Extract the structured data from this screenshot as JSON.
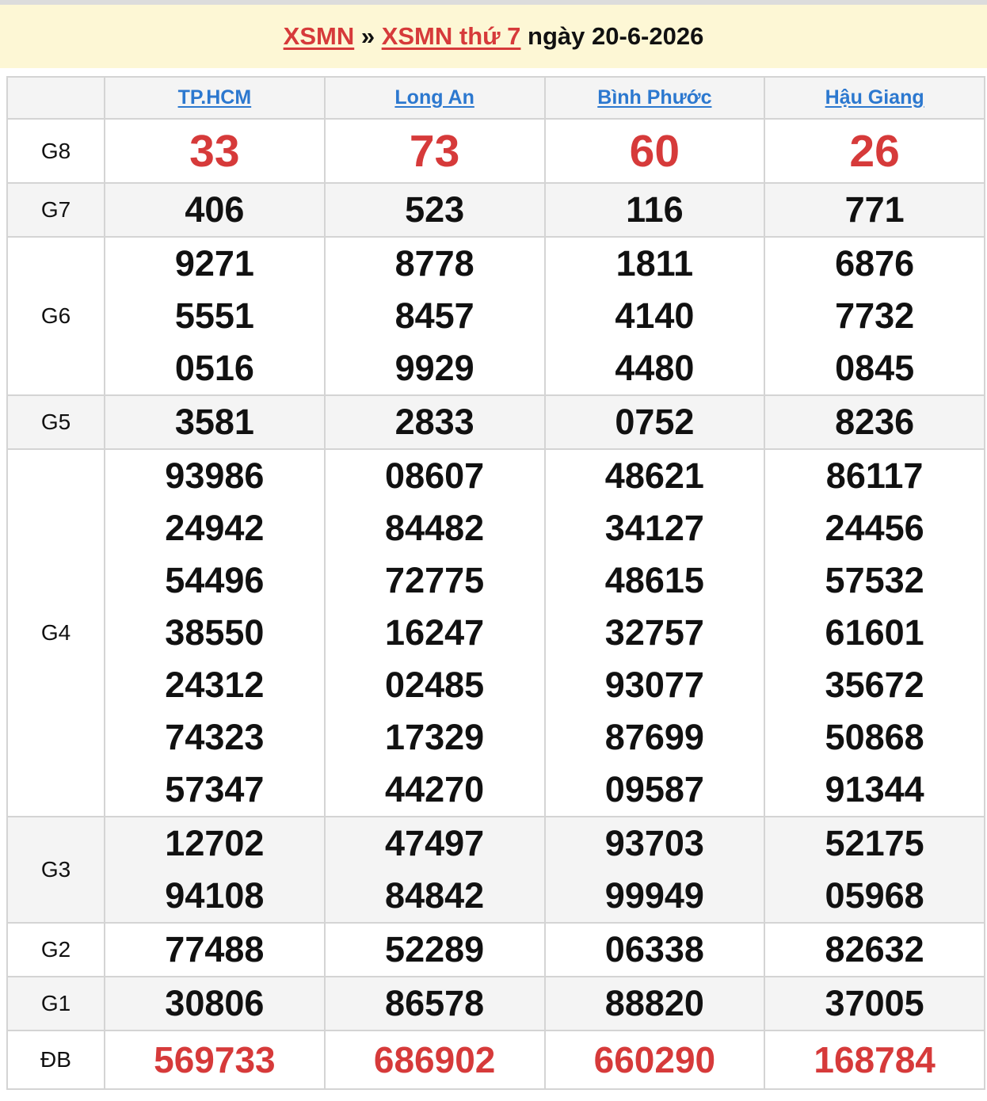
{
  "header": {
    "link1": "XSMN",
    "separator": " » ",
    "link2": "XSMN thứ 7",
    "date_text": " ngày 20-6-2026"
  },
  "provinces": [
    "TP.HCM",
    "Long An",
    "Bình Phước",
    "Hậu Giang"
  ],
  "prizes": {
    "g8": {
      "label": "G8",
      "values": [
        "33",
        "73",
        "60",
        "26"
      ]
    },
    "g7": {
      "label": "G7",
      "values": [
        "406",
        "523",
        "116",
        "771"
      ]
    },
    "g6": {
      "label": "G6",
      "values": [
        [
          "9271",
          "5551",
          "0516"
        ],
        [
          "8778",
          "8457",
          "9929"
        ],
        [
          "1811",
          "4140",
          "4480"
        ],
        [
          "6876",
          "7732",
          "0845"
        ]
      ]
    },
    "g5": {
      "label": "G5",
      "values": [
        "3581",
        "2833",
        "0752",
        "8236"
      ]
    },
    "g4": {
      "label": "G4",
      "values": [
        [
          "93986",
          "24942",
          "54496",
          "38550",
          "24312",
          "74323",
          "57347"
        ],
        [
          "08607",
          "84482",
          "72775",
          "16247",
          "02485",
          "17329",
          "44270"
        ],
        [
          "48621",
          "34127",
          "48615",
          "32757",
          "93077",
          "87699",
          "09587"
        ],
        [
          "86117",
          "24456",
          "57532",
          "61601",
          "35672",
          "50868",
          "91344"
        ]
      ]
    },
    "g3": {
      "label": "G3",
      "values": [
        [
          "12702",
          "94108"
        ],
        [
          "47497",
          "84842"
        ],
        [
          "93703",
          "99949"
        ],
        [
          "52175",
          "05968"
        ]
      ]
    },
    "g2": {
      "label": "G2",
      "values": [
        "77488",
        "52289",
        "06338",
        "82632"
      ]
    },
    "g1": {
      "label": "G1",
      "values": [
        "30806",
        "86578",
        "88820",
        "37005"
      ]
    },
    "db": {
      "label": "ĐB",
      "values": [
        "569733",
        "686902",
        "660290",
        "168784"
      ]
    }
  }
}
